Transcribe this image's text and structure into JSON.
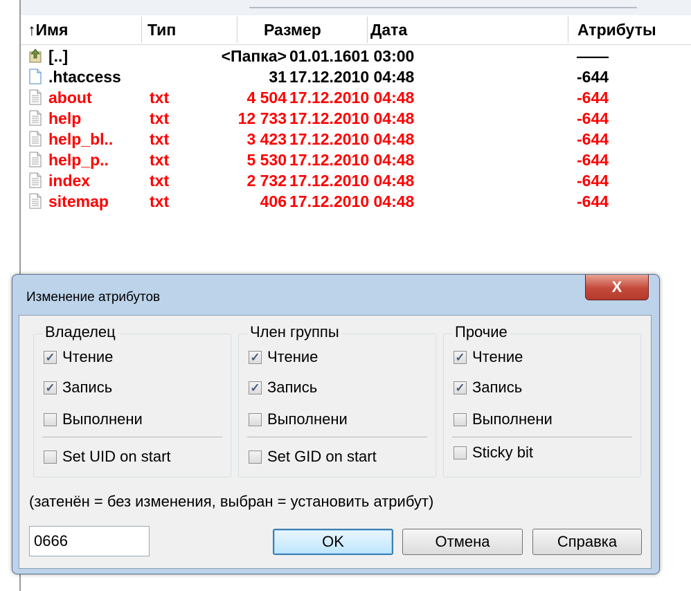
{
  "file_panel": {
    "columns": {
      "name": "↑Имя",
      "type": "Тип",
      "size": "Размер",
      "date": "Дата",
      "attributes": "Атрибуты"
    },
    "rows": [
      {
        "name": "[..]",
        "ext": "",
        "size": "<Папка>",
        "date": "01.01.1601 03:00",
        "attr": "——",
        "icon": "folder-up-icon",
        "color": "#000000"
      },
      {
        "name": ".htaccess",
        "ext": "",
        "size": "31",
        "date": "17.12.2010 04:48",
        "attr": "-644",
        "icon": "file-icon",
        "color": "#000000"
      },
      {
        "name": "about",
        "ext": "txt",
        "size": "4 504",
        "date": "17.12.2010 04:48",
        "attr": "-644",
        "icon": "text-file-icon",
        "color": "#ff0000"
      },
      {
        "name": "help",
        "ext": "txt",
        "size": "12 733",
        "date": "17.12.2010 04:48",
        "attr": "-644",
        "icon": "text-file-icon",
        "color": "#ff0000"
      },
      {
        "name": "help_bl..",
        "ext": "txt",
        "size": "3 423",
        "date": "17.12.2010 04:48",
        "attr": "-644",
        "icon": "text-file-icon",
        "color": "#ff0000"
      },
      {
        "name": "help_p..",
        "ext": "txt",
        "size": "5 530",
        "date": "17.12.2010 04:48",
        "attr": "-644",
        "icon": "text-file-icon",
        "color": "#ff0000"
      },
      {
        "name": "index",
        "ext": "txt",
        "size": "2 732",
        "date": "17.12.2010 04:48",
        "attr": "-644",
        "icon": "text-file-icon",
        "color": "#ff0000"
      },
      {
        "name": "sitemap",
        "ext": "txt",
        "size": "406",
        "date": "17.12.2010 04:48",
        "attr": "-644",
        "icon": "text-file-icon",
        "color": "#ff0000"
      }
    ]
  },
  "dialog": {
    "title": "Изменение атрибутов",
    "close_label": "X",
    "groups": {
      "owner": {
        "title": "Владелец",
        "read": {
          "label": "Чтение",
          "checked": true
        },
        "write": {
          "label": "Запись",
          "checked": true
        },
        "execute": {
          "label": "Выполнени",
          "checked": false
        },
        "special": {
          "label": "Set UID on start",
          "checked": false
        }
      },
      "group": {
        "title": "Член группы",
        "read": {
          "label": "Чтение",
          "checked": true
        },
        "write": {
          "label": "Запись",
          "checked": true
        },
        "execute": {
          "label": "Выполнени",
          "checked": false
        },
        "special": {
          "label": "Set GID on start",
          "checked": false
        }
      },
      "others": {
        "title": "Прочие",
        "read": {
          "label": "Чтение",
          "checked": true
        },
        "write": {
          "label": "Запись",
          "checked": true
        },
        "execute": {
          "label": "Выполнени",
          "checked": false
        },
        "special": {
          "label": "Sticky bit",
          "checked": false
        }
      }
    },
    "hint": "(затенён = без изменения, выбран = установить атрибут)",
    "mode_value": "0666",
    "buttons": {
      "ok": "OK",
      "cancel": "Отмена",
      "help": "Справка"
    }
  }
}
